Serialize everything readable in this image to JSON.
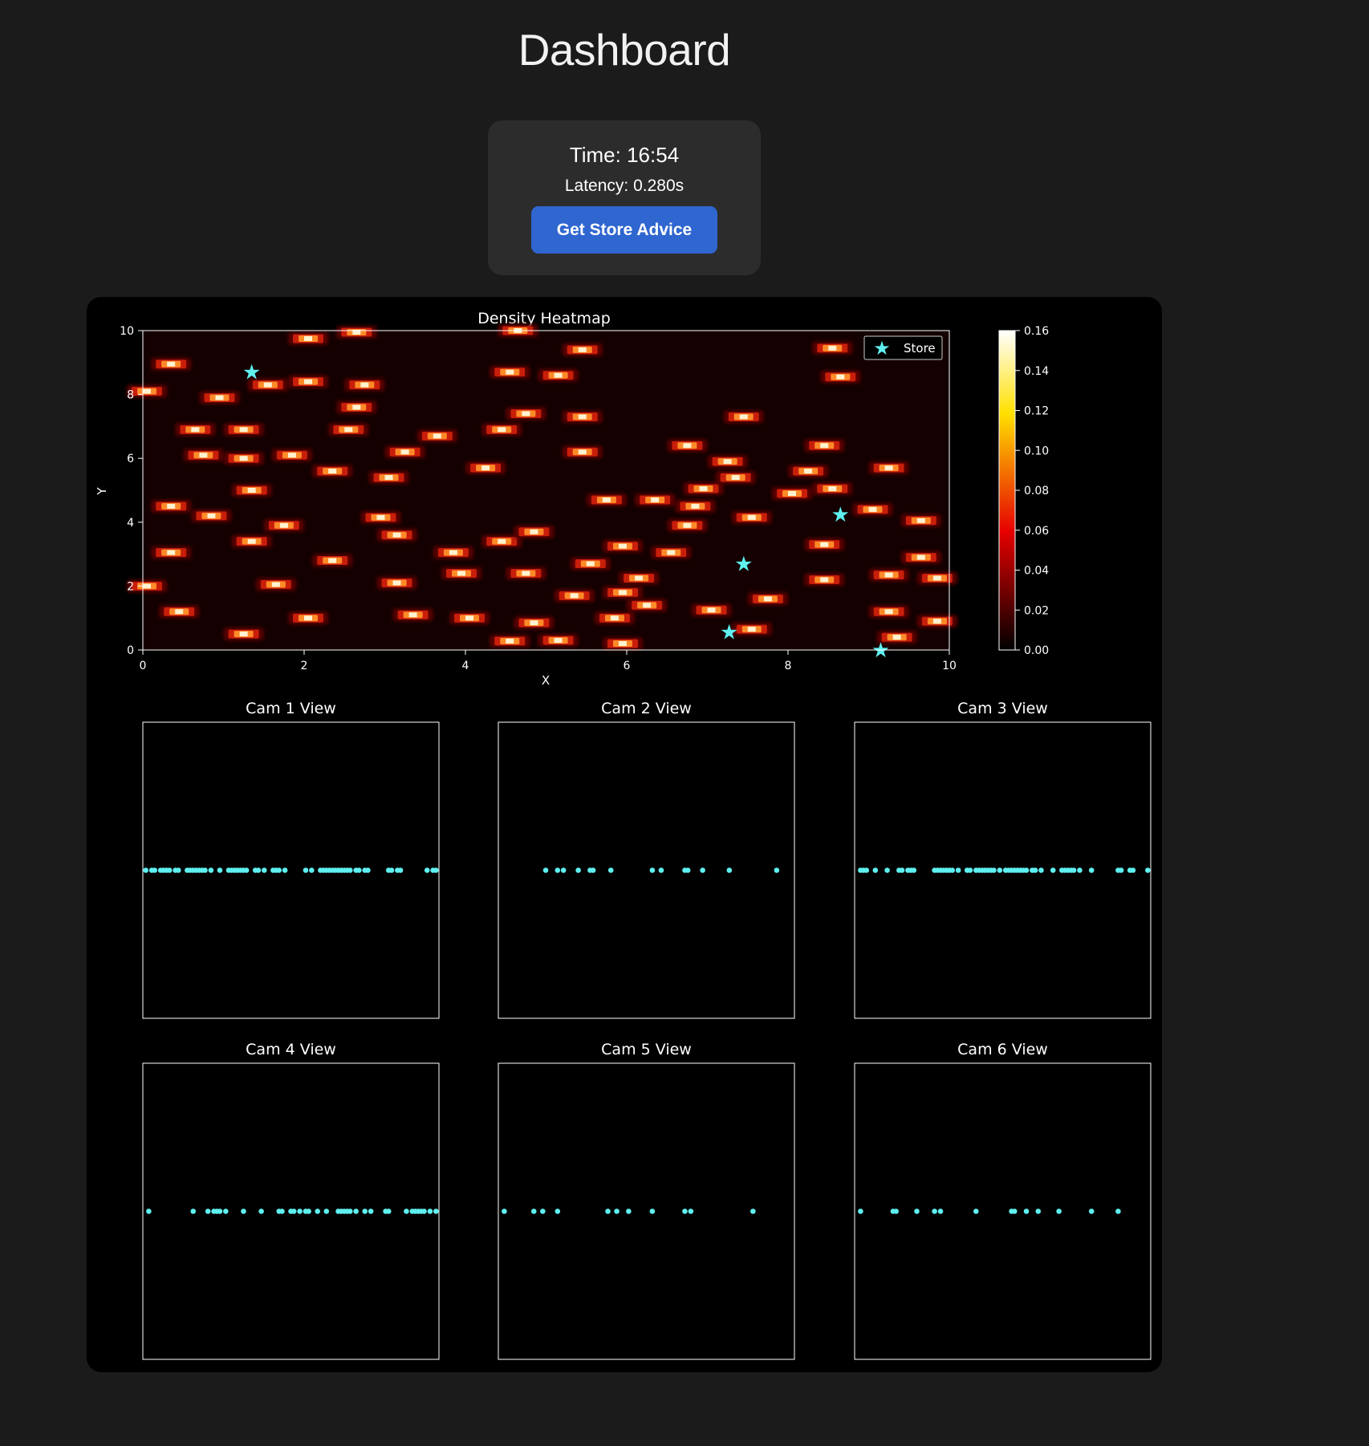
{
  "header": {
    "title": "Dashboard"
  },
  "status": {
    "time_label": "Time: 16:54",
    "latency_label": "Latency: 0.280s",
    "advice_button_label": "Get Store Advice"
  },
  "colors": {
    "background": "#1b1b1b",
    "card": "#2c2c2c",
    "button": "#2f66d0",
    "marker": "#5ff0f0"
  },
  "icons": {
    "store_marker": "star-icon"
  },
  "chart_data": [
    {
      "type": "heatmap",
      "title": "Density Heatmap",
      "xlabel": "X",
      "ylabel": "Y",
      "xlim": [
        0,
        10
      ],
      "ylim": [
        0,
        10
      ],
      "xticks": [
        "0",
        "2",
        "4",
        "6",
        "8",
        "10"
      ],
      "yticks": [
        "0",
        "2",
        "4",
        "6",
        "8",
        "10"
      ],
      "colormap": "hot",
      "colorbar": {
        "range": [
          0,
          0.16
        ],
        "ticks": [
          "0.00",
          "0.02",
          "0.04",
          "0.06",
          "0.08",
          "0.10",
          "0.12",
          "0.14",
          "0.16"
        ]
      },
      "legend": {
        "label": "Store",
        "placement": "top-right"
      },
      "stores": [
        [
          1.35,
          8.7
        ],
        [
          8.65,
          4.25
        ],
        [
          7.45,
          2.7
        ],
        [
          7.27,
          0.57
        ],
        [
          9.15,
          0.0
        ]
      ],
      "hotspots": [
        [
          0.35,
          8.95
        ],
        [
          0.05,
          8.1
        ],
        [
          0.35,
          4.5
        ],
        [
          0.35,
          3.05
        ],
        [
          0.05,
          2.0
        ],
        [
          0.45,
          1.2
        ],
        [
          0.65,
          6.9
        ],
        [
          0.75,
          6.1
        ],
        [
          0.95,
          7.9
        ],
        [
          0.85,
          4.2
        ],
        [
          1.25,
          6.9
        ],
        [
          1.25,
          6.0
        ],
        [
          1.35,
          5.0
        ],
        [
          1.35,
          3.4
        ],
        [
          1.25,
          0.5
        ],
        [
          1.55,
          8.3
        ],
        [
          1.75,
          3.9
        ],
        [
          1.65,
          2.05
        ],
        [
          1.85,
          6.1
        ],
        [
          2.05,
          9.75
        ],
        [
          2.05,
          8.4
        ],
        [
          2.05,
          1.0
        ],
        [
          2.35,
          5.6
        ],
        [
          2.35,
          2.8
        ],
        [
          2.65,
          9.95
        ],
        [
          2.75,
          8.3
        ],
        [
          2.65,
          7.6
        ],
        [
          2.55,
          6.9
        ],
        [
          2.95,
          4.15
        ],
        [
          3.05,
          5.4
        ],
        [
          3.25,
          6.2
        ],
        [
          3.15,
          3.6
        ],
        [
          3.15,
          2.1
        ],
        [
          3.35,
          1.1
        ],
        [
          3.65,
          6.7
        ],
        [
          3.85,
          3.05
        ],
        [
          3.95,
          2.4
        ],
        [
          4.05,
          1.0
        ],
        [
          4.45,
          6.9
        ],
        [
          4.25,
          5.7
        ],
        [
          4.45,
          3.4
        ],
        [
          4.55,
          8.7
        ],
        [
          4.65,
          10.0
        ],
        [
          4.55,
          0.28
        ],
        [
          4.75,
          7.4
        ],
        [
          4.75,
          2.4
        ],
        [
          4.85,
          3.7
        ],
        [
          4.85,
          0.85
        ],
        [
          5.15,
          8.6
        ],
        [
          5.15,
          0.3
        ],
        [
          5.45,
          9.4
        ],
        [
          5.45,
          7.3
        ],
        [
          5.45,
          6.2
        ],
        [
          5.35,
          1.7
        ],
        [
          5.55,
          2.7
        ],
        [
          5.75,
          4.7
        ],
        [
          5.95,
          3.25
        ],
        [
          5.95,
          1.8
        ],
        [
          5.85,
          1.0
        ],
        [
          5.95,
          0.2
        ],
        [
          6.15,
          2.25
        ],
        [
          6.25,
          1.4
        ],
        [
          6.35,
          4.7
        ],
        [
          6.55,
          3.05
        ],
        [
          6.75,
          3.9
        ],
        [
          6.75,
          6.4
        ],
        [
          6.85,
          4.5
        ],
        [
          6.95,
          5.05
        ],
        [
          7.05,
          1.25
        ],
        [
          7.25,
          5.9
        ],
        [
          7.35,
          5.4
        ],
        [
          7.45,
          7.3
        ],
        [
          7.55,
          4.15
        ],
        [
          7.55,
          0.65
        ],
        [
          7.75,
          1.6
        ],
        [
          8.05,
          4.9
        ],
        [
          8.25,
          5.6
        ],
        [
          8.45,
          6.4
        ],
        [
          8.45,
          3.3
        ],
        [
          8.45,
          2.2
        ],
        [
          8.55,
          9.45
        ],
        [
          8.65,
          8.55
        ],
        [
          8.55,
          5.05
        ],
        [
          9.05,
          4.4
        ],
        [
          9.25,
          5.7
        ],
        [
          9.25,
          2.35
        ],
        [
          9.25,
          1.2
        ],
        [
          9.35,
          0.4
        ],
        [
          9.65,
          4.05
        ],
        [
          9.65,
          2.9
        ],
        [
          9.85,
          2.25
        ],
        [
          9.85,
          0.9
        ]
      ]
    },
    {
      "type": "scatter",
      "title": "Cam 1 View",
      "y": 0.5,
      "x": [
        0.01,
        0.03,
        0.04,
        0.06,
        0.07,
        0.08,
        0.09,
        0.11,
        0.12,
        0.15,
        0.16,
        0.17,
        0.18,
        0.19,
        0.2,
        0.21,
        0.23,
        0.26,
        0.29,
        0.3,
        0.31,
        0.32,
        0.33,
        0.34,
        0.35,
        0.38,
        0.39,
        0.41,
        0.44,
        0.45,
        0.46,
        0.48,
        0.55,
        0.57,
        0.6,
        0.61,
        0.62,
        0.63,
        0.64,
        0.65,
        0.66,
        0.67,
        0.68,
        0.69,
        0.7,
        0.72,
        0.73,
        0.75,
        0.76,
        0.83,
        0.84,
        0.86,
        0.87,
        0.96,
        0.98,
        0.99
      ]
    },
    {
      "type": "scatter",
      "title": "Cam 2 View",
      "y": 0.5,
      "x": [
        0.16,
        0.2,
        0.22,
        0.27,
        0.31,
        0.32,
        0.38,
        0.52,
        0.55,
        0.63,
        0.64,
        0.69,
        0.78,
        0.94
      ]
    },
    {
      "type": "scatter",
      "title": "Cam 3 View",
      "y": 0.5,
      "x": [
        0.02,
        0.03,
        0.04,
        0.07,
        0.11,
        0.15,
        0.16,
        0.18,
        0.19,
        0.2,
        0.27,
        0.28,
        0.29,
        0.3,
        0.31,
        0.32,
        0.33,
        0.35,
        0.38,
        0.39,
        0.41,
        0.42,
        0.43,
        0.44,
        0.45,
        0.46,
        0.47,
        0.49,
        0.51,
        0.52,
        0.53,
        0.54,
        0.55,
        0.56,
        0.57,
        0.58,
        0.6,
        0.61,
        0.63,
        0.67,
        0.7,
        0.71,
        0.72,
        0.73,
        0.74,
        0.76,
        0.8,
        0.89,
        0.9,
        0.93,
        0.94,
        0.99
      ]
    },
    {
      "type": "scatter",
      "title": "Cam 4 View",
      "y": 0.5,
      "x": [
        0.02,
        0.17,
        0.22,
        0.24,
        0.25,
        0.26,
        0.28,
        0.34,
        0.4,
        0.46,
        0.47,
        0.5,
        0.51,
        0.53,
        0.55,
        0.56,
        0.59,
        0.62,
        0.66,
        0.67,
        0.68,
        0.69,
        0.7,
        0.72,
        0.75,
        0.77,
        0.82,
        0.83,
        0.89,
        0.91,
        0.92,
        0.93,
        0.94,
        0.95,
        0.97,
        0.99
      ]
    },
    {
      "type": "scatter",
      "title": "Cam 5 View",
      "y": 0.5,
      "x": [
        0.02,
        0.12,
        0.15,
        0.2,
        0.37,
        0.4,
        0.44,
        0.52,
        0.63,
        0.65,
        0.86
      ]
    },
    {
      "type": "scatter",
      "title": "Cam 6 View",
      "y": 0.5,
      "x": [
        0.02,
        0.13,
        0.14,
        0.21,
        0.27,
        0.29,
        0.41,
        0.53,
        0.54,
        0.58,
        0.62,
        0.69,
        0.8,
        0.89
      ]
    }
  ]
}
